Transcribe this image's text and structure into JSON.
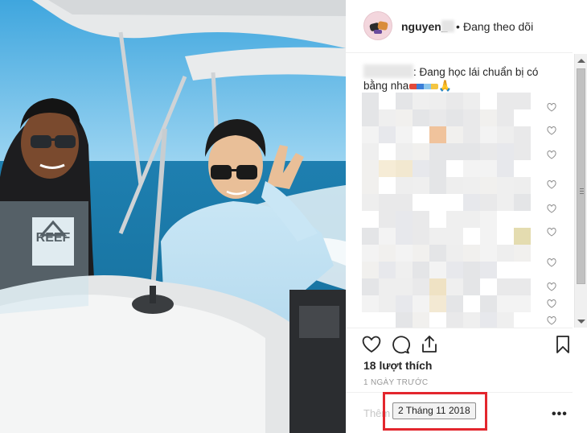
{
  "header": {
    "username": "nguyen_",
    "separator": "•",
    "follow_status": "Đang theo dõi"
  },
  "caption": {
    "text": ": Đang học lái chuẩn bị có bằng nha",
    "emoji_tail": "🙏"
  },
  "actions": {
    "likes": "18 lượt thích",
    "time_ago": "1 NGÀY TRƯỚC"
  },
  "comment_box": {
    "placeholder": "Thêm"
  },
  "more_label": "•••",
  "tooltip": {
    "date": "2 Tháng 11 2018"
  },
  "colors": {
    "highlight_border": "#e3262d",
    "text_primary": "#262626",
    "text_muted": "#999999"
  }
}
